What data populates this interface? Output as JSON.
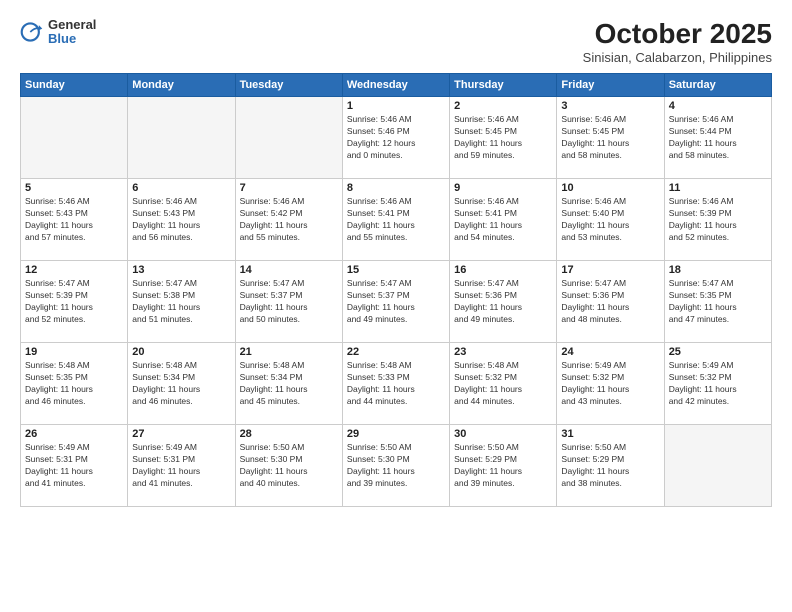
{
  "logo": {
    "general": "General",
    "blue": "Blue"
  },
  "title": "October 2025",
  "subtitle": "Sinisian, Calabarzon, Philippines",
  "weekdays": [
    "Sunday",
    "Monday",
    "Tuesday",
    "Wednesday",
    "Thursday",
    "Friday",
    "Saturday"
  ],
  "weeks": [
    [
      {
        "day": "",
        "info": ""
      },
      {
        "day": "",
        "info": ""
      },
      {
        "day": "",
        "info": ""
      },
      {
        "day": "1",
        "info": "Sunrise: 5:46 AM\nSunset: 5:46 PM\nDaylight: 12 hours\nand 0 minutes."
      },
      {
        "day": "2",
        "info": "Sunrise: 5:46 AM\nSunset: 5:45 PM\nDaylight: 11 hours\nand 59 minutes."
      },
      {
        "day": "3",
        "info": "Sunrise: 5:46 AM\nSunset: 5:45 PM\nDaylight: 11 hours\nand 58 minutes."
      },
      {
        "day": "4",
        "info": "Sunrise: 5:46 AM\nSunset: 5:44 PM\nDaylight: 11 hours\nand 58 minutes."
      }
    ],
    [
      {
        "day": "5",
        "info": "Sunrise: 5:46 AM\nSunset: 5:43 PM\nDaylight: 11 hours\nand 57 minutes."
      },
      {
        "day": "6",
        "info": "Sunrise: 5:46 AM\nSunset: 5:43 PM\nDaylight: 11 hours\nand 56 minutes."
      },
      {
        "day": "7",
        "info": "Sunrise: 5:46 AM\nSunset: 5:42 PM\nDaylight: 11 hours\nand 55 minutes."
      },
      {
        "day": "8",
        "info": "Sunrise: 5:46 AM\nSunset: 5:41 PM\nDaylight: 11 hours\nand 55 minutes."
      },
      {
        "day": "9",
        "info": "Sunrise: 5:46 AM\nSunset: 5:41 PM\nDaylight: 11 hours\nand 54 minutes."
      },
      {
        "day": "10",
        "info": "Sunrise: 5:46 AM\nSunset: 5:40 PM\nDaylight: 11 hours\nand 53 minutes."
      },
      {
        "day": "11",
        "info": "Sunrise: 5:46 AM\nSunset: 5:39 PM\nDaylight: 11 hours\nand 52 minutes."
      }
    ],
    [
      {
        "day": "12",
        "info": "Sunrise: 5:47 AM\nSunset: 5:39 PM\nDaylight: 11 hours\nand 52 minutes."
      },
      {
        "day": "13",
        "info": "Sunrise: 5:47 AM\nSunset: 5:38 PM\nDaylight: 11 hours\nand 51 minutes."
      },
      {
        "day": "14",
        "info": "Sunrise: 5:47 AM\nSunset: 5:37 PM\nDaylight: 11 hours\nand 50 minutes."
      },
      {
        "day": "15",
        "info": "Sunrise: 5:47 AM\nSunset: 5:37 PM\nDaylight: 11 hours\nand 49 minutes."
      },
      {
        "day": "16",
        "info": "Sunrise: 5:47 AM\nSunset: 5:36 PM\nDaylight: 11 hours\nand 49 minutes."
      },
      {
        "day": "17",
        "info": "Sunrise: 5:47 AM\nSunset: 5:36 PM\nDaylight: 11 hours\nand 48 minutes."
      },
      {
        "day": "18",
        "info": "Sunrise: 5:47 AM\nSunset: 5:35 PM\nDaylight: 11 hours\nand 47 minutes."
      }
    ],
    [
      {
        "day": "19",
        "info": "Sunrise: 5:48 AM\nSunset: 5:35 PM\nDaylight: 11 hours\nand 46 minutes."
      },
      {
        "day": "20",
        "info": "Sunrise: 5:48 AM\nSunset: 5:34 PM\nDaylight: 11 hours\nand 46 minutes."
      },
      {
        "day": "21",
        "info": "Sunrise: 5:48 AM\nSunset: 5:34 PM\nDaylight: 11 hours\nand 45 minutes."
      },
      {
        "day": "22",
        "info": "Sunrise: 5:48 AM\nSunset: 5:33 PM\nDaylight: 11 hours\nand 44 minutes."
      },
      {
        "day": "23",
        "info": "Sunrise: 5:48 AM\nSunset: 5:32 PM\nDaylight: 11 hours\nand 44 minutes."
      },
      {
        "day": "24",
        "info": "Sunrise: 5:49 AM\nSunset: 5:32 PM\nDaylight: 11 hours\nand 43 minutes."
      },
      {
        "day": "25",
        "info": "Sunrise: 5:49 AM\nSunset: 5:32 PM\nDaylight: 11 hours\nand 42 minutes."
      }
    ],
    [
      {
        "day": "26",
        "info": "Sunrise: 5:49 AM\nSunset: 5:31 PM\nDaylight: 11 hours\nand 41 minutes."
      },
      {
        "day": "27",
        "info": "Sunrise: 5:49 AM\nSunset: 5:31 PM\nDaylight: 11 hours\nand 41 minutes."
      },
      {
        "day": "28",
        "info": "Sunrise: 5:50 AM\nSunset: 5:30 PM\nDaylight: 11 hours\nand 40 minutes."
      },
      {
        "day": "29",
        "info": "Sunrise: 5:50 AM\nSunset: 5:30 PM\nDaylight: 11 hours\nand 39 minutes."
      },
      {
        "day": "30",
        "info": "Sunrise: 5:50 AM\nSunset: 5:29 PM\nDaylight: 11 hours\nand 39 minutes."
      },
      {
        "day": "31",
        "info": "Sunrise: 5:50 AM\nSunset: 5:29 PM\nDaylight: 11 hours\nand 38 minutes."
      },
      {
        "day": "",
        "info": ""
      }
    ]
  ]
}
